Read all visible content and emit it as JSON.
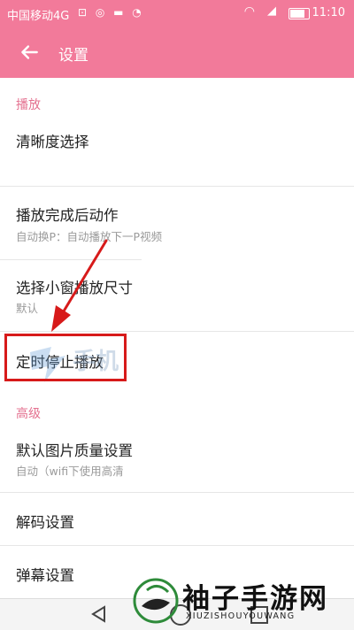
{
  "status_bar": {
    "carrier": "中国移动4G",
    "clock": "11:10"
  },
  "app_bar": {
    "title": "设置"
  },
  "sections": {
    "playback": "播放",
    "advanced": "高级"
  },
  "items": [
    {
      "label": "清晰度选择",
      "sub": ""
    },
    {
      "label": "播放完成后动作",
      "sub": "自动换P：自动播放下一P视频"
    },
    {
      "label": "选择小窗播放尺寸",
      "sub": "默认"
    },
    {
      "label": "定时停止播放",
      "sub": ""
    },
    {
      "label": "默认图片质量设置",
      "sub": "自动（wifi下使用高清"
    },
    {
      "label": "解码设置",
      "sub": ""
    },
    {
      "label": "弹幕设置",
      "sub": ""
    }
  ],
  "watermark": {
    "text": "手机",
    "brand_name": "袖子手游网",
    "brand_sub": "XIUZISHOUYOUWANG"
  },
  "colors": {
    "accent": "#f27a9a",
    "highlight": "#d71a1a"
  }
}
